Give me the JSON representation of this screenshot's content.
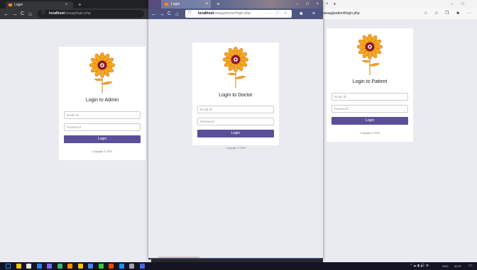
{
  "windows": {
    "chrome": {
      "tab_title": "Login",
      "tab_close": "×",
      "new_tab": "+",
      "nav_back": "←",
      "nav_forward": "→",
      "nav_reload": "C",
      "nav_home": "⌂",
      "info_icon": "ⓘ",
      "url_host": "localhost",
      "url_path": "/seaag/login.php",
      "login_title": "Login to Admin",
      "email_placeholder": "Email ID",
      "password_placeholder": "Password",
      "login_button": "Login",
      "copyright": "Copyright © 2020"
    },
    "firefox": {
      "tab_title": "Login",
      "tab_close": "×",
      "new_tab": "+",
      "minimize": "–",
      "maximize": "□",
      "close": "×",
      "nav_back": "←",
      "nav_forward": "→",
      "nav_reload": "C",
      "nav_home": "⌂",
      "shield": "⛉",
      "url_host": "localhost",
      "url_path": "/seaag/doctor/login.php",
      "url_actions": "··· ♡ ☆",
      "toolbar_right": "⫼ ▢ ☻ ≡",
      "login_title": "Login to Doctor",
      "email_placeholder": "Email ID",
      "password_placeholder": "Password",
      "login_button": "Login",
      "copyright": "Copyright © 2020"
    },
    "edge": {
      "tab_close": "×",
      "new_tab": "+",
      "minimize": "–",
      "maximize": "□",
      "url_text": "seaag/patient/login.php",
      "icons": [
        "☆",
        "✩",
        "❐",
        "☻",
        "···"
      ],
      "login_title": "Login to Patient",
      "email_placeholder": "Email ID",
      "password_placeholder": "Password",
      "login_button": "Login",
      "copyright": "Copyright © 2020"
    }
  },
  "taskbar": {
    "tray_text": "^ ☁ ▮ 🔊 ⊕",
    "language": "ENG",
    "time": "00:07",
    "colors": [
      "#1e90ff",
      "#f4c20d",
      "#e8e8e8",
      "#2b7de9",
      "#7b68ee",
      "#3cb371",
      "#ff8c00",
      "#f4c20d",
      "#4285f4",
      "#32cd32",
      "#ff4500",
      "#1e90ff",
      "#a0a0a0",
      "#4169e1"
    ]
  },
  "colors": {
    "accent_button": "#5b4f9a",
    "page_bg": "#e9ebf0",
    "petal": "#f4a71d",
    "petal_outline": "#d2691e",
    "flower_center": "#8b1a2a"
  }
}
